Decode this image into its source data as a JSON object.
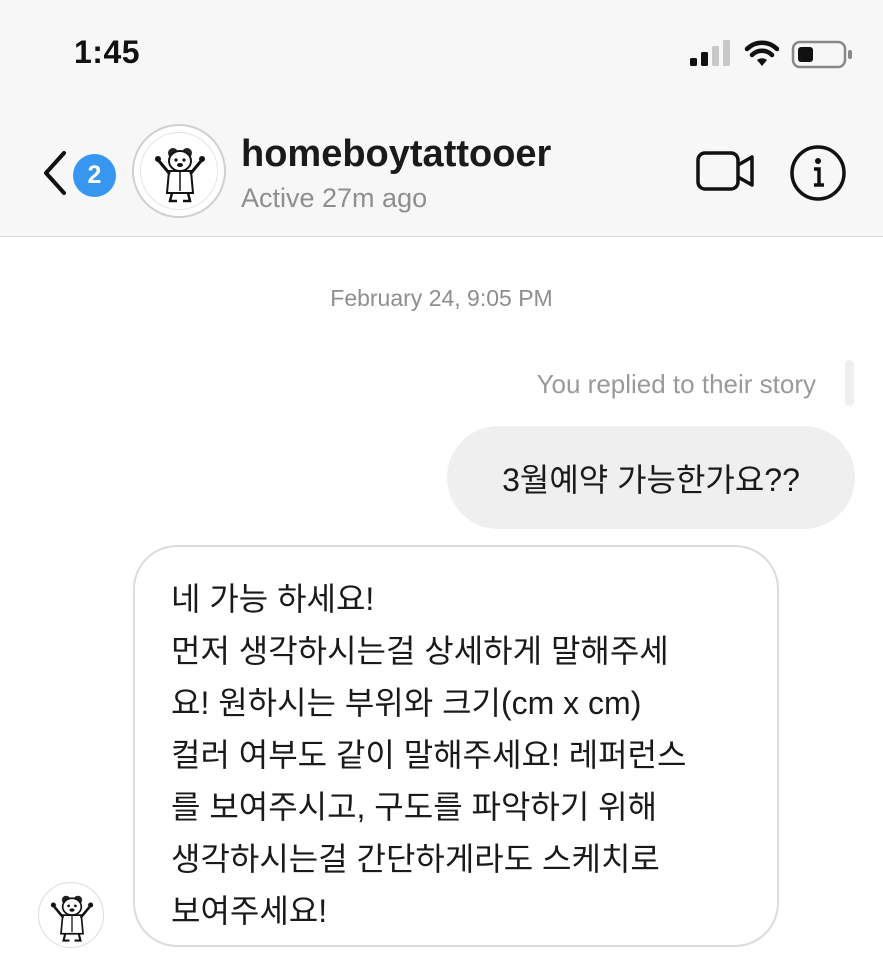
{
  "status_bar": {
    "time": "1:45",
    "icons": [
      "cellular-signal-icon",
      "wifi-icon",
      "battery-icon"
    ]
  },
  "header": {
    "back_badge": "2",
    "username": "homeboytattooer",
    "active_status": "Active 27m ago",
    "icons": [
      "back-chevron-icon",
      "video-call-icon",
      "info-icon"
    ]
  },
  "chat": {
    "date_stamp": "February 24, 9:05 PM",
    "reply_note": "You replied to their story",
    "outgoing_message": "3월예약 가능한가요??",
    "incoming_message_lines": [
      "네 가능 하세요!",
      "먼저 생각하시는걸 상세하게 말해주세",
      "요! 원하시는 부위와 크기(cm x cm)",
      "컬러 여부도 같이 말해주세요! 레퍼런스",
      "를 보여주시고, 구도를 파악하기 위해",
      "생각하시는걸 간단하게라도 스케치로",
      "보여주세요!"
    ]
  },
  "colors": {
    "badge_blue": "#3797f0",
    "header_bg": "#f7f7f7",
    "outgoing_bubble": "#efefef",
    "incoming_border": "#dbdbdb",
    "muted_text": "#8e8e8e"
  }
}
